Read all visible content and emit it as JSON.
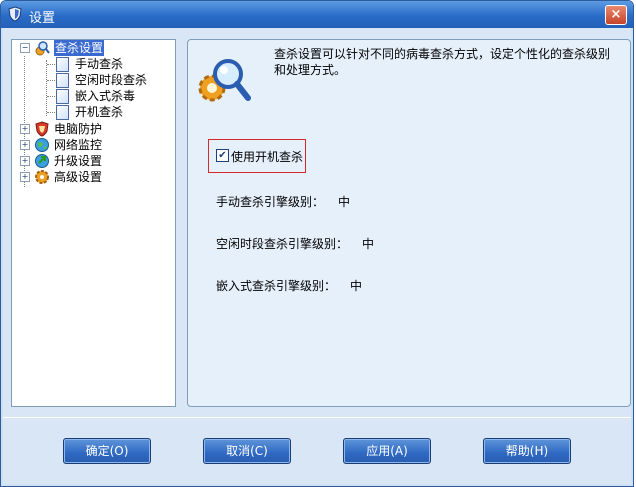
{
  "window": {
    "title": "设置",
    "close_glyph": "×",
    "icon": "shield-icon"
  },
  "tree": {
    "nodes": [
      {
        "label": "查杀设置",
        "icon": "magnifier-gear-icon",
        "expanded": true,
        "selected": true
      },
      {
        "label": "手动查杀",
        "icon": "document-icon"
      },
      {
        "label": "空闲时段查杀",
        "icon": "document-icon"
      },
      {
        "label": "嵌入式杀毒",
        "icon": "document-icon"
      },
      {
        "label": "开机查杀",
        "icon": "document-icon"
      },
      {
        "label": "电脑防护",
        "icon": "shield-icon",
        "expanded": false
      },
      {
        "label": "网络监控",
        "icon": "globe-icon",
        "expanded": false
      },
      {
        "label": "升级设置",
        "icon": "globe-arrow-icon",
        "expanded": false
      },
      {
        "label": "高级设置",
        "icon": "gear-icon",
        "expanded": false
      }
    ],
    "expand_glyph": "+",
    "collapse_glyph": "−"
  },
  "panel": {
    "description": "查杀设置可以针对不同的病毒查杀方式，设定个性化的查杀级别和处理方式。",
    "checkbox": {
      "label": "使用开机查杀",
      "checked": true,
      "mark": "✔"
    },
    "rows": [
      {
        "label": "手动查杀引擎级别：",
        "value": "中"
      },
      {
        "label": "空闲时段查杀引擎级别：",
        "value": "中"
      },
      {
        "label": "嵌入式查杀引擎级别：",
        "value": "中"
      }
    ]
  },
  "buttons": {
    "ok": "确定(O)",
    "cancel": "取消(C)",
    "apply": "应用(A)",
    "help": "帮助(H)"
  }
}
